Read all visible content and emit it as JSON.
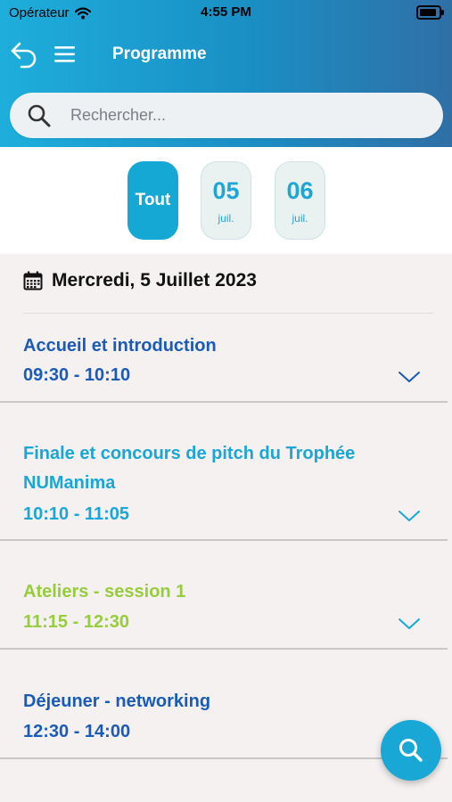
{
  "status_bar": {
    "carrier": "Opérateur",
    "time": "4:55 PM"
  },
  "nav": {
    "title": "Programme"
  },
  "search": {
    "placeholder": "Rechercher..."
  },
  "date_filter": {
    "all_label": "Tout",
    "days": [
      {
        "day": "05",
        "month": "juil."
      },
      {
        "day": "06",
        "month": "juil."
      }
    ]
  },
  "day_header": {
    "label": "Mercredi, 5 Juillet 2023"
  },
  "sessions": [
    {
      "title": "Accueil et introduction",
      "time": "09:30 - 10:10",
      "color": "#1a5bb8"
    },
    {
      "title_line1": "Finale et concours de pitch du Trophée",
      "title_line2": "NUManima",
      "time": "10:10 - 11:05",
      "color": "#1aa6d6"
    },
    {
      "title": "Ateliers - session 1",
      "time": "11:15 - 12:30",
      "color": "#97cc3c"
    },
    {
      "title": "Déjeuner - networking",
      "time": "12:30 - 14:00",
      "color": "#1a5bb8"
    }
  ],
  "colors": {
    "accent": "#16a8d5",
    "header_start": "#1eaedc",
    "header_end": "#2f6fa6"
  }
}
